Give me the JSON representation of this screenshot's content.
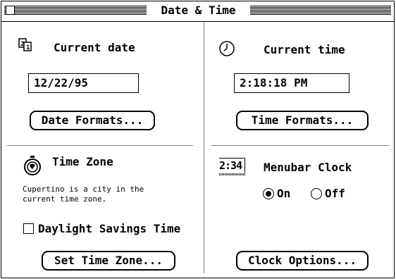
{
  "window": {
    "title": "Date & Time"
  },
  "date": {
    "heading": "Current date",
    "value": "12/22/95",
    "formats_button": "Date Formats..."
  },
  "time": {
    "heading": "Current time",
    "value": "2:18:18 PM",
    "formats_button": "Time Formats..."
  },
  "timezone": {
    "heading": "Time Zone",
    "description_line1": "Cupertino is a city in the",
    "description_line2": "current time zone.",
    "dst_label": "Daylight Savings Time",
    "dst_checked": false,
    "set_button": "Set Time Zone..."
  },
  "menubar_clock": {
    "heading": "Menubar Clock",
    "icon_text": "2:34",
    "on_label": "On",
    "off_label": "Off",
    "selected": "On",
    "options_button": "Clock Options..."
  }
}
